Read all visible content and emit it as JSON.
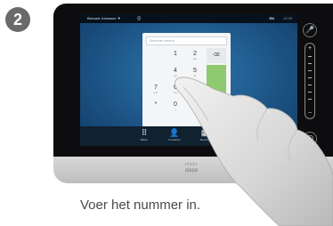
{
  "step": {
    "number": "2"
  },
  "status_bar": {
    "user": "Bernard Johnsson ▼",
    "info_icon": "info-icon",
    "language": "EN",
    "clock": "12:29"
  },
  "dialpad": {
    "placeholder": "Nummer kiezen",
    "keys": [
      {
        "digit": "1",
        "letters": ""
      },
      {
        "digit": "2",
        "letters": "abc"
      },
      {
        "digit": "3",
        "letters": "def"
      },
      {
        "digit": "4",
        "letters": "ghi"
      },
      {
        "digit": "5",
        "letters": "jkl"
      },
      {
        "digit": "6",
        "letters": "mno"
      },
      {
        "digit": "7",
        "letters": "pqrs"
      },
      {
        "digit": "8",
        "letters": "tuv"
      },
      {
        "digit": "9",
        "letters": "wxyz"
      },
      {
        "digit": "*",
        "letters": ""
      },
      {
        "digit": "0",
        "letters": "+"
      },
      {
        "digit": "#",
        "letters": ""
      }
    ],
    "backspace_icon": "backspace-icon",
    "more_label": "•••",
    "call_color": "#8fc970"
  },
  "taskbar": {
    "items": [
      {
        "label": "Bellen",
        "icon": "keypad-icon"
      },
      {
        "label": "Contacten",
        "icon": "contacts-icon"
      },
      {
        "label": "Meeting",
        "icon": "calendar-icon"
      },
      {
        "label": "Share",
        "icon": "share-icon"
      }
    ]
  },
  "side_panel": {
    "mute_icon": "mute-icon",
    "volume_plus": "+",
    "volume_minus": "−",
    "home_icon": "home-icon"
  },
  "brand": {
    "name": "cisco",
    "bars": "ılıılı"
  },
  "caption": "Voer het nummer in."
}
